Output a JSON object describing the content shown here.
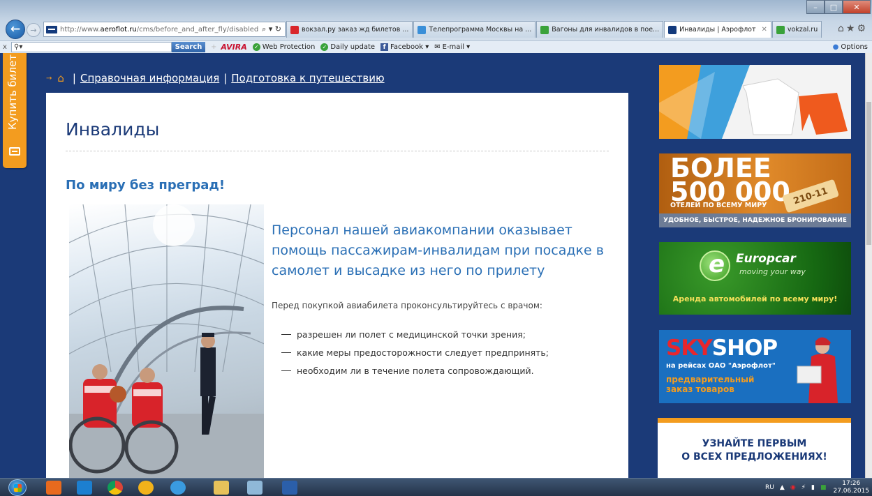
{
  "browser": {
    "url_prefix": "http://www.",
    "url_domain": "aeroflot.ru",
    "url_path": "/cms/before_and_after_fly/disabled",
    "address_icons": "⌕ ▾ ↻",
    "tabs": [
      {
        "label": "вокзал.ру заказ жд билетов ...",
        "color": "#d9262b"
      },
      {
        "label": "Телепрограмма Москвы на ...",
        "color": "#3a8fd8"
      },
      {
        "label": "Вагоны для инвалидов в пое...",
        "color": "#3aa23a"
      },
      {
        "label": "Инвалиды | Аэрофлот",
        "color": "#133a7c",
        "active": true
      },
      {
        "label": "vokzal.ru",
        "color": "#3aa23a"
      }
    ],
    "toolbar": {
      "search_label": "Search",
      "avira": "AVIRA",
      "web_protection": "Web Protection",
      "daily_update": "Daily update",
      "facebook": "Facebook ▾",
      "email": "E-mail ▾",
      "options": "Options"
    }
  },
  "page": {
    "buy_ticket": "Купить билет",
    "breadcrumb": {
      "links": [
        "Справочная информация",
        "Подготовка к путешествию"
      ],
      "separator": "|"
    },
    "title": "Инвалиды",
    "subtitle": "По миру без преград!",
    "lead": "Персонал нашей авиакомпании оказывает помощь пассажирам-инвалидам при посадке в самолет и высадке из него по прилету",
    "note": "Перед покупкой авиабилета проконсультируйтесь с врачом:",
    "list": [
      "разрешен ли полет с медицинской точки зрения;",
      "какие меры предосторожности следует предпринять;",
      "необходим ли в течение полета сопровождающий."
    ]
  },
  "ads": {
    "hotels": {
      "line1": "БОЛЕЕ",
      "line2": "500 000",
      "small": "ОТЕЛЕЙ ПО ВСЕМУ МИРУ",
      "tag": "210-11",
      "bar": "УДОБНОЕ, БЫСТРОЕ, НАДЕЖНОЕ БРОНИРОВАНИЕ"
    },
    "europcar": {
      "brand": "Europcar",
      "motto": "moving your way",
      "text": "Аренда автомобилей по всему миру!"
    },
    "skyshop": {
      "sky": "SKY",
      "shop": "SHOP",
      "sub": "на рейсах ОАО \"Аэрофлот\"",
      "pre": "предварительный заказ товаров"
    },
    "subscribe": {
      "line1": "УЗНАЙТЕ ПЕРВЫМ",
      "line2": "О ВСЕХ ПРЕДЛОЖЕНИЯХ!"
    }
  },
  "taskbar": {
    "lang": "RU",
    "time": "17:26",
    "date": "27.06.2015"
  }
}
